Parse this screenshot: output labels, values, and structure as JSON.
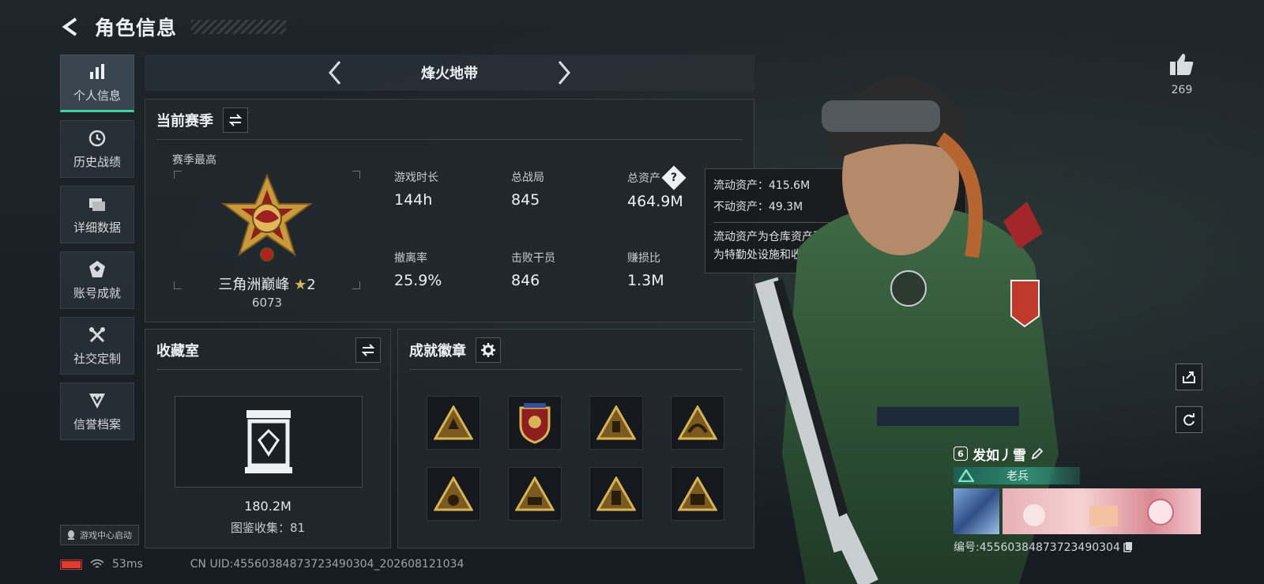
{
  "header": {
    "title": "角色信息"
  },
  "nav": {
    "items": [
      {
        "label": "个人信息",
        "icon": "bar-chart-icon",
        "active": true
      },
      {
        "label": "历史战绩",
        "icon": "clock-icon",
        "active": false
      },
      {
        "label": "详细数据",
        "icon": "folder-icon",
        "active": false
      },
      {
        "label": "账号成就",
        "icon": "achievement-icon",
        "active": false
      },
      {
        "label": "社交定制",
        "icon": "tools-icon",
        "active": false
      },
      {
        "label": "信誉档案",
        "icon": "credit-icon",
        "active": false
      }
    ],
    "launch_label": "游戏中心启动"
  },
  "mode": {
    "name": "烽火地带"
  },
  "season": {
    "title": "当前赛季",
    "best_label": "赛季最高",
    "rank_name": "三角洲巅峰",
    "rank_stars": "2",
    "rank_score": "6073",
    "stats": [
      {
        "label": "游戏时长",
        "value": "144h"
      },
      {
        "label": "总战局",
        "value": "845"
      },
      {
        "label": "总资产",
        "value": "464.9M"
      },
      {
        "label": "撤离率",
        "value": "25.9%"
      },
      {
        "label": "击败干员",
        "value": "846"
      },
      {
        "label": "赚损比",
        "value": "1.3M"
      }
    ]
  },
  "tooltip": {
    "liquid": "流动资产：415.6M",
    "fixed": "不动资产：49.3M",
    "desc_line1": "流动资产为仓库资产和哈夫币，不动资产",
    "desc_line2": "为特勤处设施和收藏室设施"
  },
  "vault": {
    "title": "收藏室",
    "value": "180.2M",
    "collection": "图鉴收集：81"
  },
  "badges": {
    "title": "成就徽章",
    "items": [
      "badge-1",
      "badge-2",
      "badge-3",
      "badge-4",
      "badge-5",
      "badge-6",
      "badge-7",
      "badge-8"
    ]
  },
  "status": {
    "ping": "53ms",
    "uid": "CN UID:4556038487372349030​4_202608121034"
  },
  "social": {
    "likes": "269"
  },
  "card": {
    "rank_chip": "6",
    "player_name": "发如丿雪",
    "title": "老兵",
    "player_id": "编号:45560384873723490304"
  },
  "colors": {
    "accent": "#3fd3a3",
    "gold": "#c99a3c",
    "battery": "#e23a2e"
  }
}
